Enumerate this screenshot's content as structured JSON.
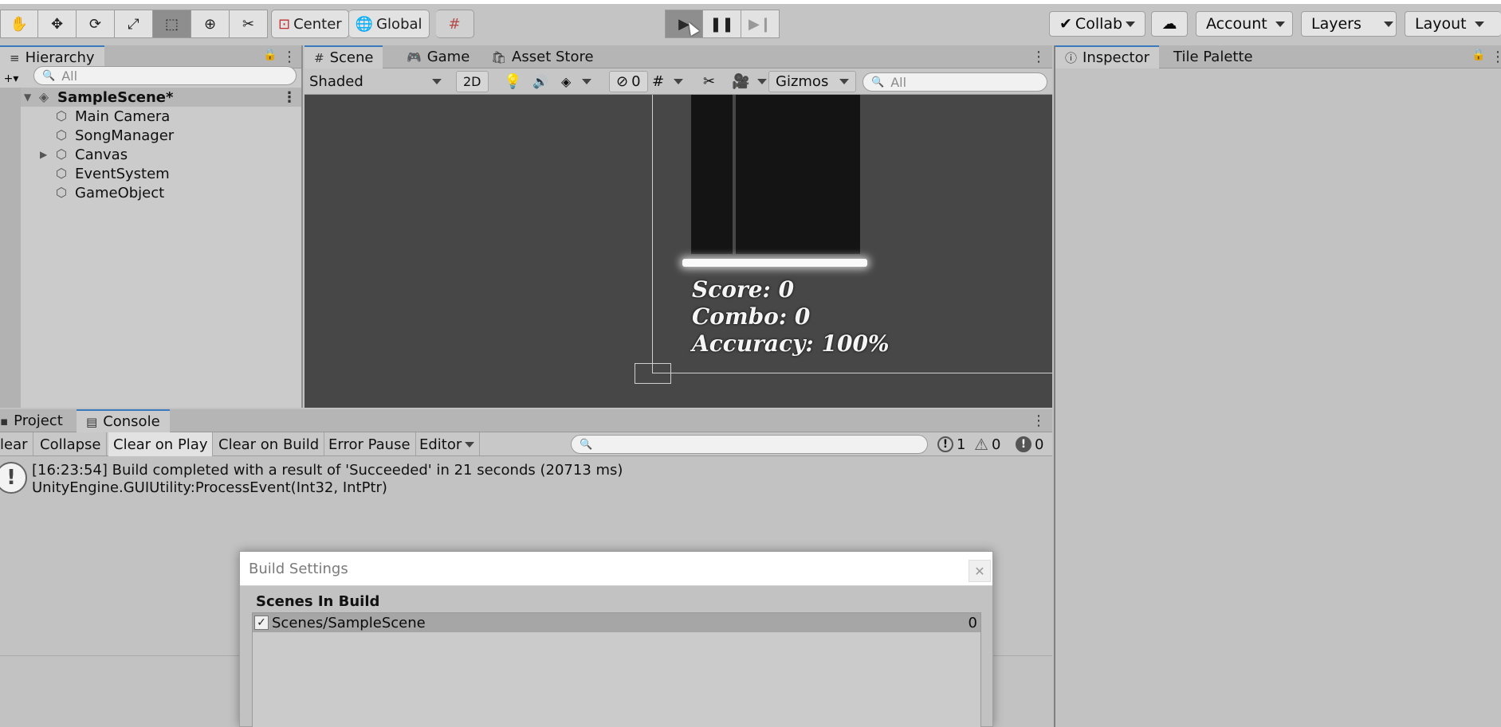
{
  "toolbar": {
    "pivot_label": "Center",
    "space_label": "Global",
    "collab_label": "Collab",
    "account_label": "Account",
    "layers_label": "Layers",
    "layout_label": "Layout"
  },
  "hierarchy": {
    "tab_label": "Hierarchy",
    "search_placeholder": "All",
    "scene_name": "SampleScene*",
    "items": [
      {
        "label": "Main Camera"
      },
      {
        "label": "SongManager"
      },
      {
        "label": "Canvas"
      },
      {
        "label": "EventSystem"
      },
      {
        "label": "GameObject"
      }
    ]
  },
  "scene_panel": {
    "tabs": [
      {
        "label": "Scene"
      },
      {
        "label": "Game"
      },
      {
        "label": "Asset Store"
      }
    ],
    "shading_mode": "Shaded",
    "mode_2d_label": "2D",
    "hidden_count": "0",
    "gizmos_label": "Gizmos",
    "search_placeholder": "All"
  },
  "game_view": {
    "score_text": "Score: 0",
    "combo_text": "Combo: 0",
    "accuracy_text": "Accuracy: 100%"
  },
  "inspector": {
    "tabs": [
      {
        "label": "Inspector"
      },
      {
        "label": "Tile Palette"
      }
    ]
  },
  "console": {
    "tabs": [
      {
        "label": "Project"
      },
      {
        "label": "Console"
      }
    ],
    "buttons": {
      "clear": "lear",
      "collapse": "Collapse",
      "clear_on_play": "Clear on Play",
      "clear_on_build": "Clear on Build",
      "error_pause": "Error Pause",
      "editor": "Editor"
    },
    "counts": {
      "info": "1",
      "warnings": "0",
      "errors": "0"
    },
    "log": {
      "line1": "[16:23:54] Build completed with a result of 'Succeeded' in 21 seconds (20713 ms)",
      "line2": "UnityEngine.GUIUtility:ProcessEvent(Int32, IntPtr)"
    }
  },
  "build_settings": {
    "title": "Build Settings",
    "section_label": "Scenes In Build",
    "scenes": [
      {
        "path": "Scenes/SampleScene",
        "index": "0",
        "enabled": true
      }
    ]
  }
}
